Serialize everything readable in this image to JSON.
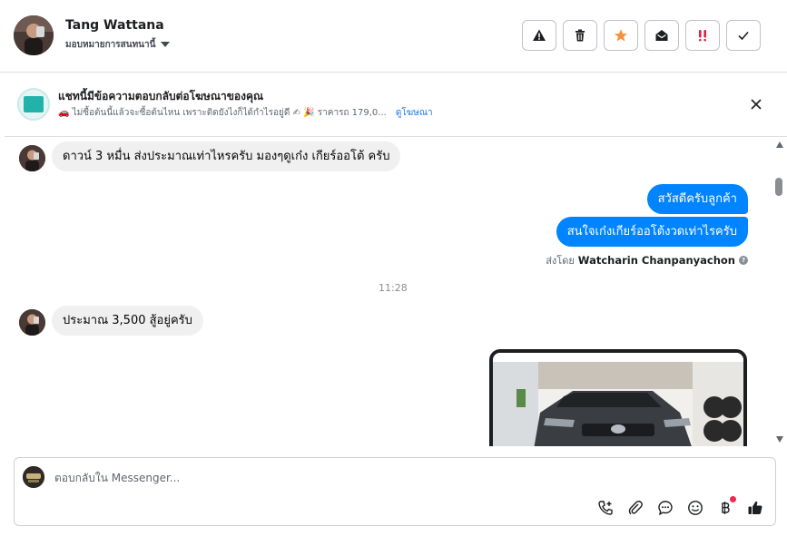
{
  "header": {
    "contact_name": "Tang Wattana",
    "assign_label": "มอบหมายการสนทนานี้",
    "toolbar_icons": [
      "warning-icon",
      "trash-icon",
      "star-icon",
      "open-envelope-icon",
      "urgent-icon",
      "checkmark-icon"
    ],
    "star_color": "#f7923b",
    "urgent_color": "#e41e3f"
  },
  "ad_banner": {
    "title": "แชทนี้มีข้อความตอบกลับต่อโฆษณาของคุณ",
    "subtitle": "🚗 ไม่ซื้อต้นนี้แล้วจะซื้อต้นไหน เพราะติดยังไงก็ได้กำไรอยู่ดี ✍ 🎉 ราคารถ 179,0...",
    "link": "ดูโฆษณา"
  },
  "messages": {
    "incoming_1": "ดาวน์ 3 หมื่น ส่งประมาณเท่าไหรครับ มองๆดูเก๋ง เกียร์ออโต้ ครับ",
    "outgoing_1": "สวัสดีครับลูกค้า",
    "outgoing_2": "สนใจเก๋งเกียร์ออโต้งวดเท่าไรครับ",
    "sent_by_prefix": "ส่งโดย",
    "sent_by_name": "Watcharin Chanpanyachon",
    "timestamp": "11:28",
    "incoming_2": "ประมาณ 3,500 สู้อยู่ครับ",
    "outgoing_bubble_color": "#0084ff"
  },
  "composer": {
    "placeholder": "ตอบกลับใน Messenger...",
    "value": "",
    "tool_icons": [
      "call-add-icon",
      "attachment-icon",
      "saved-reply-icon",
      "emoji-icon",
      "baht-payment-icon",
      "thumbs-up-icon"
    ]
  }
}
